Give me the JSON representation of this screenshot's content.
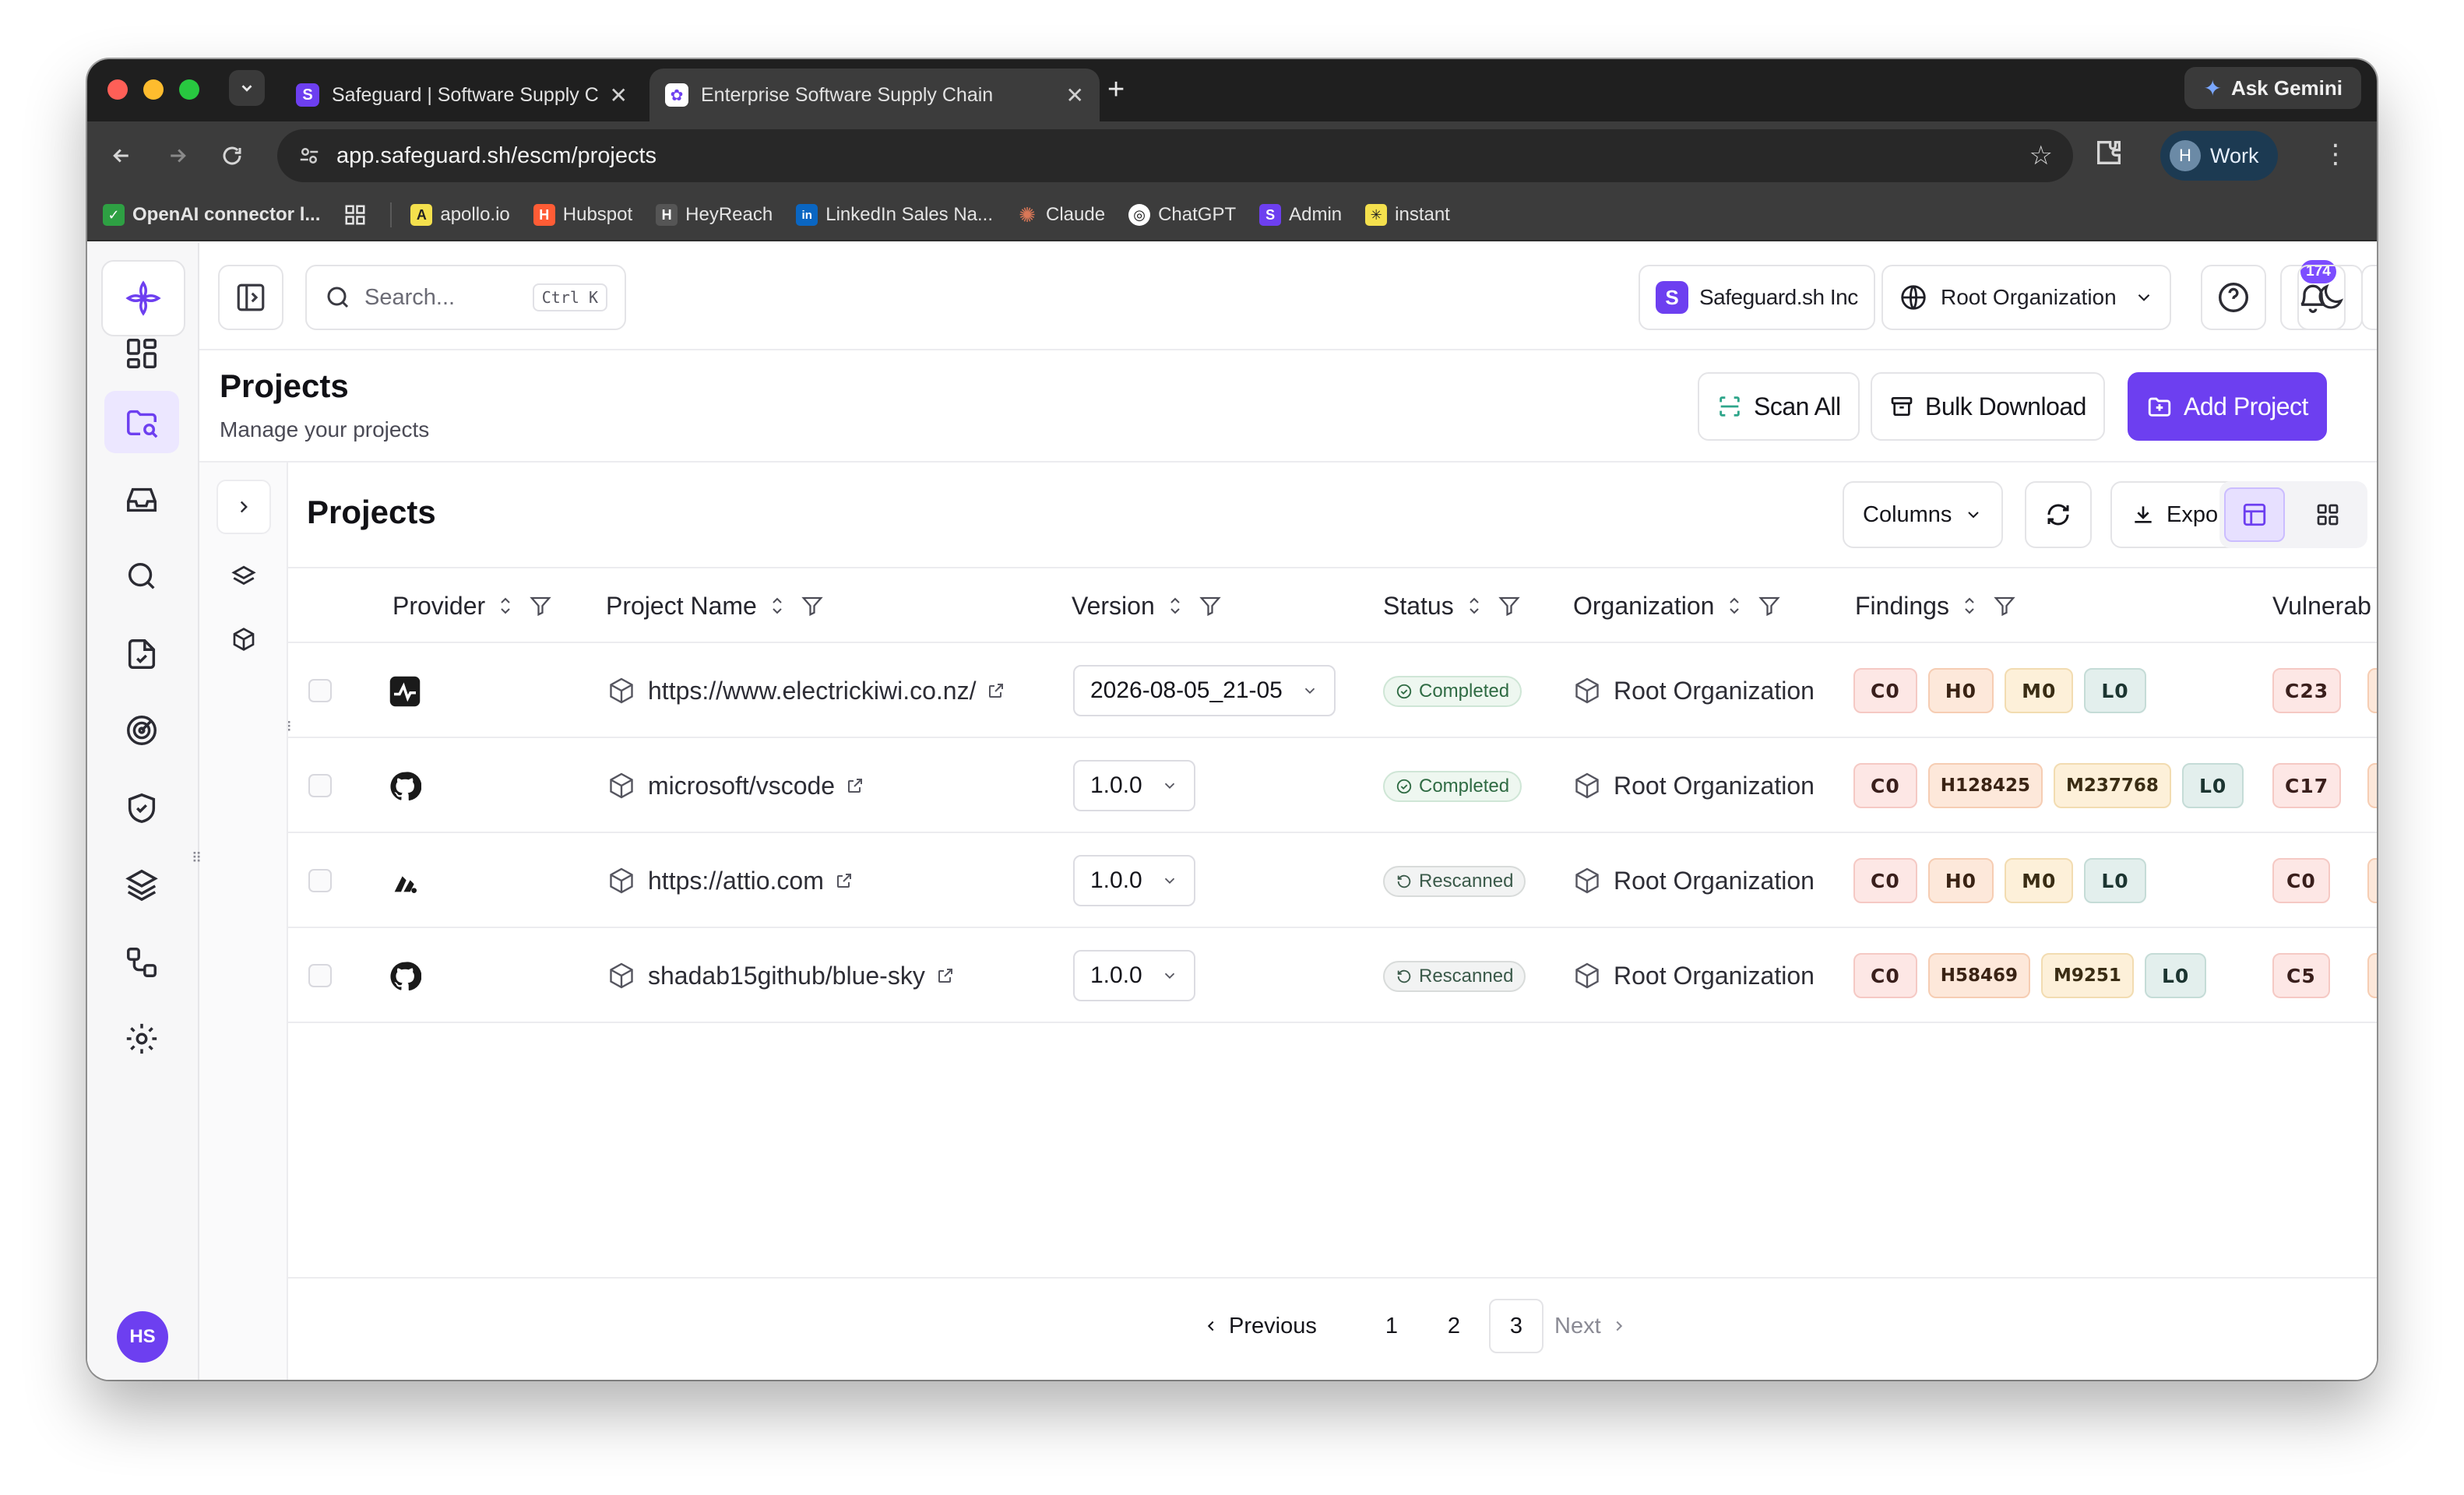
{
  "browser": {
    "tabs": [
      {
        "title": "Safeguard | Software Supply Chain",
        "favicon": "S",
        "favicon_color": "#6d3ff0",
        "active": false
      },
      {
        "title": "Enterprise Software Supply Chain",
        "favicon": "✿",
        "favicon_color": "#6d3ff0",
        "active": true
      }
    ],
    "url": "app.safeguard.sh/escm/projects",
    "gemini_label": "Ask Gemini",
    "profile_initial": "H",
    "profile_label": "Work",
    "bookmarks": [
      {
        "label": "OpenAI connector l...",
        "icon_bg": "#2ea043",
        "icon": "✓"
      },
      {
        "label": "",
        "icon": "apps-grid-icon"
      },
      {
        "label": "apollo.io",
        "icon_bg": "#f4e04d",
        "icon": "A"
      },
      {
        "label": "Hubspot",
        "icon_bg": "#ff5c35",
        "icon": "H"
      },
      {
        "label": "HeyReach",
        "icon_bg": "#555555",
        "icon": "H"
      },
      {
        "label": "LinkedIn Sales Na...",
        "icon_bg": "#0a66c2",
        "icon": "in"
      },
      {
        "label": "Claude",
        "icon_bg": "#d97757",
        "icon": "✺"
      },
      {
        "label": "ChatGPT",
        "icon_bg": "#ffffff",
        "icon": "◎"
      },
      {
        "label": "Admin",
        "icon_bg": "#6d3ff0",
        "icon": "S"
      },
      {
        "label": "instant",
        "icon_bg": "#f4e04d",
        "icon": "✳"
      }
    ]
  },
  "topbar": {
    "search_placeholder": "Search...",
    "search_shortcut": "Ctrl K",
    "company": "Safeguard.sh Inc",
    "org_selector": "Root Organization",
    "notification_count": "174"
  },
  "page": {
    "title": "Projects",
    "subtitle": "Manage your projects",
    "actions": {
      "scan_all": "Scan All",
      "bulk_download": "Bulk Download",
      "add_project": "Add Project"
    }
  },
  "panel": {
    "title": "Projects",
    "columns_btn": "Columns",
    "export_btn": "Export"
  },
  "table": {
    "headers": {
      "provider": "Provider",
      "project_name": "Project Name",
      "version": "Version",
      "status": "Status",
      "organization": "Organization",
      "findings": "Findings",
      "vulnerabilities": "Vulnerab"
    },
    "rows": [
      {
        "provider": "activity-icon",
        "name": "https://www.electrickiwi.co.nz/",
        "version": "2026-08-05_21-05",
        "status": "Completed",
        "organization": "Root Organization",
        "findings": {
          "c": "C0",
          "h": "H0",
          "m": "M0",
          "l": "L0"
        },
        "vuln_c": "C23"
      },
      {
        "provider": "github-icon",
        "name": "microsoft/vscode",
        "version": "1.0.0",
        "status": "Completed",
        "organization": "Root Organization",
        "findings": {
          "c": "C0",
          "h": "H128425",
          "m": "M237768",
          "l": "L0"
        },
        "vuln_c": "C17"
      },
      {
        "provider": "attio-icon",
        "name": "https://attio.com",
        "version": "1.0.0",
        "status": "Rescanned",
        "organization": "Root Organization",
        "findings": {
          "c": "C0",
          "h": "H0",
          "m": "M0",
          "l": "L0"
        },
        "vuln_c": "C0"
      },
      {
        "provider": "github-icon",
        "name": "shadab15github/blue-sky",
        "version": "1.0.0",
        "status": "Rescanned",
        "organization": "Root Organization",
        "findings": {
          "c": "C0",
          "h": "H58469",
          "m": "M9251",
          "l": "L0"
        },
        "vuln_c": "C5"
      }
    ]
  },
  "pagination": {
    "previous": "Previous",
    "pages": [
      "1",
      "2",
      "3"
    ],
    "current": "3",
    "next": "Next"
  },
  "user": {
    "initials": "HS"
  },
  "colors": {
    "accent": "#6d3ff0",
    "critical": "#fde7e5",
    "high": "#fde8da",
    "medium": "#fdf0d9",
    "low": "#e3efed"
  }
}
